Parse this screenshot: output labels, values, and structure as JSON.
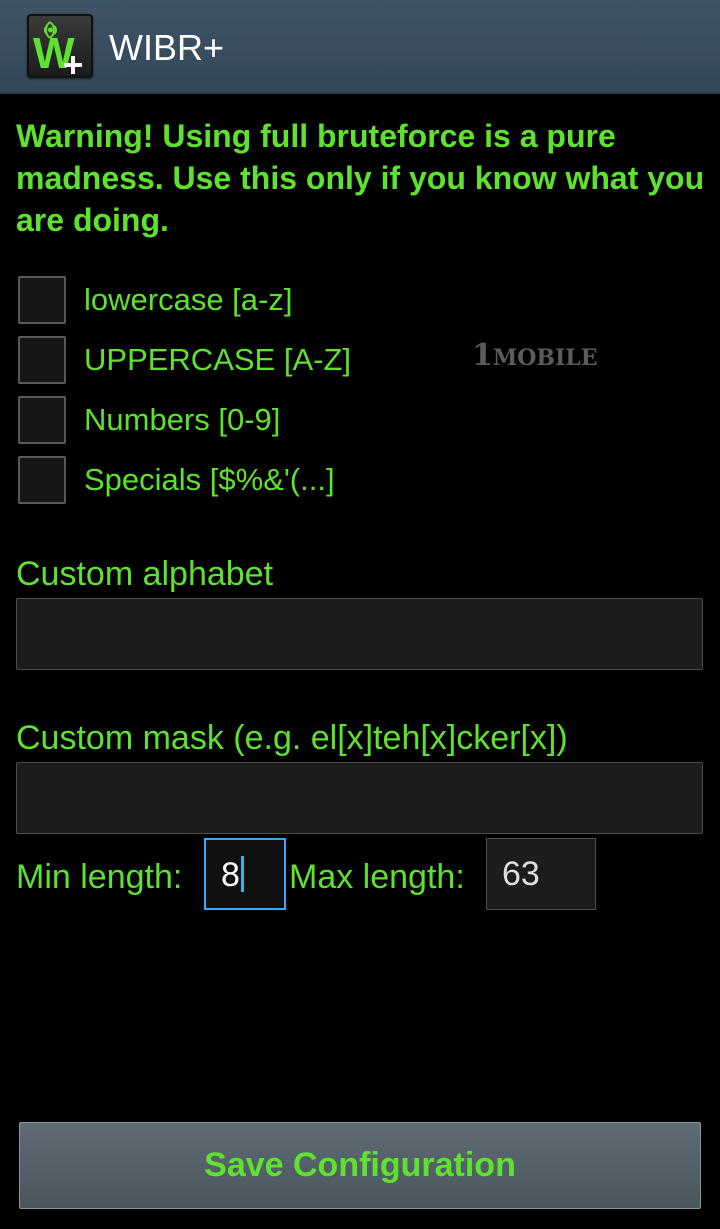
{
  "app": {
    "title": "WIBR+",
    "icon": "wibr-plus-logo-icon"
  },
  "warning_text": "Warning! Using full bruteforce is a pure madness. Use this only if you know what you are doing.",
  "charsets": [
    {
      "label": "lowercase [a-z]",
      "checked": false
    },
    {
      "label": "UPPERCASE [A-Z]",
      "checked": false
    },
    {
      "label": "Numbers [0-9]",
      "checked": false
    },
    {
      "label": "Specials [$%&'(...]",
      "checked": false
    }
  ],
  "watermark": {
    "digit": "1",
    "text": "MOBILE"
  },
  "custom_alphabet": {
    "label": "Custom alphabet",
    "value": ""
  },
  "custom_mask": {
    "label": "Custom mask (e.g. el[x]teh[x]cker[x])",
    "value": ""
  },
  "length": {
    "min_label": "Min length:",
    "min_value": "8",
    "max_label": "Max length:",
    "max_value": "63"
  },
  "save_button_label": "Save Configuration",
  "colors": {
    "accent_green": "#5ee12f",
    "actionbar": "#3a4e60",
    "focus_blue": "#33b5e5",
    "background": "#000000"
  }
}
